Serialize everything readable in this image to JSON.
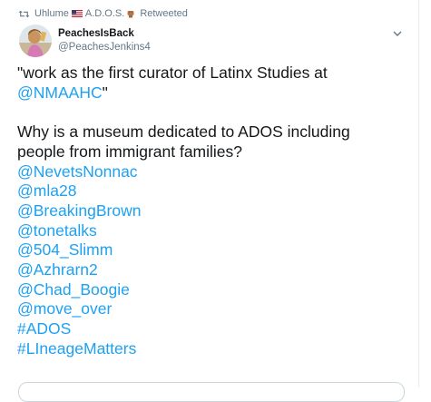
{
  "retweet": {
    "icon": "retweet-icon",
    "name": "Uhlume",
    "flag": "us-flag-icon",
    "ados": "A.D.O.S.",
    "emoji": "raised-fist-icon",
    "action": "Retweeted"
  },
  "author": {
    "display_name": "PeachesIsBack",
    "handle": "@PeachesJenkins4"
  },
  "tweet": {
    "quote_line1": "\"work as the first curator of Latinx Studies at",
    "quote_mention": "@NMAAHC",
    "quote_end": "\"",
    "question_line1": "Why is a museum dedicated to ADOS including",
    "question_line2": "people from immigrant families?",
    "tags": [
      "@NevetsNonnac",
      "@mla28",
      "@BreakingBrown",
      "@tonetalks",
      "@504_Slimm",
      "@Azhrarn2",
      "@Chad_Boogie",
      "@move_over",
      "#ADOS",
      "#LIneageMatters"
    ]
  },
  "colors": {
    "link": "#1da1f2",
    "text": "#14171a",
    "muted": "#657786"
  }
}
